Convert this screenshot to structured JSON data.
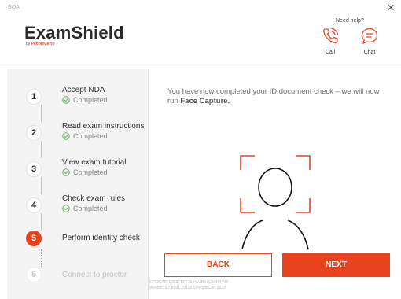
{
  "window": {
    "label": "SQA",
    "close_glyph": "×"
  },
  "brand": {
    "name": "ExamShield",
    "by": "by",
    "company": "PeopleCert",
    "trademark": "®"
  },
  "help": {
    "title": "Need help?",
    "call_label": "Call",
    "chat_label": "Chat",
    "call_icon": "phone-ringing-icon",
    "chat_icon": "chat-bubble-icon"
  },
  "steps": [
    {
      "number": "1",
      "title": "Accept NDA",
      "status": "Completed",
      "state": "completed"
    },
    {
      "number": "2",
      "title": "Read exam instructions",
      "status": "Completed",
      "state": "completed"
    },
    {
      "number": "3",
      "title": "View exam tutorial",
      "status": "Completed",
      "state": "completed"
    },
    {
      "number": "4",
      "title": "Check exam rules",
      "status": "Completed",
      "state": "completed"
    },
    {
      "number": "5",
      "title": "Perform identity check",
      "status": "",
      "state": "active"
    },
    {
      "number": "6",
      "title": "Connect to proctor",
      "status": "",
      "state": "pending"
    }
  ],
  "main": {
    "message_prefix": "You have now completed your ID document check – we will now run ",
    "message_bold": "Face Capture.",
    "illustration_icon": "face-capture-icon"
  },
  "buttons": {
    "back_label": "BACK",
    "next_label": "NEXT"
  },
  "footer": {
    "line1": "EF69C7BFE861FBFF30-HV3B5YC8XHTY9F",
    "line2": "Version: 5.7.8591.29139 ©PeopleCert 2022"
  },
  "colors": {
    "accent": "#e8421f",
    "completed_green": "#5cb85c",
    "sidebar_bg": "#f4f4f4"
  }
}
